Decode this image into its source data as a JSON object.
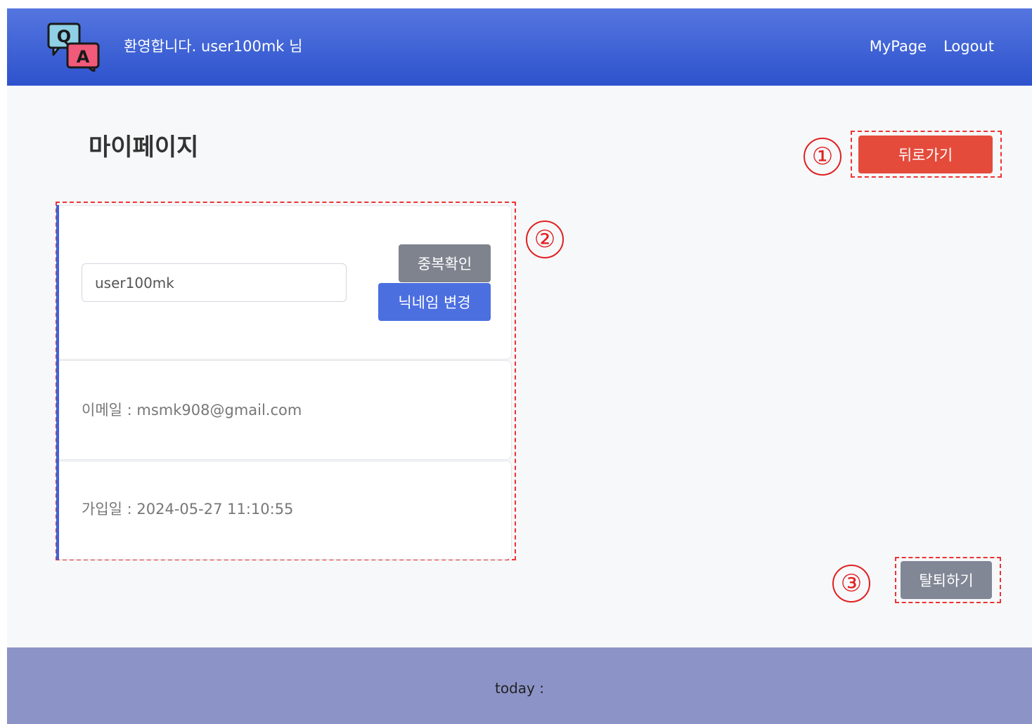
{
  "header": {
    "welcome": "환영합니다. user100mk 님",
    "nav": {
      "mypage": "MyPage",
      "logout": "Logout"
    },
    "logo": {
      "q": "Q",
      "a": "A"
    }
  },
  "page": {
    "title": "마이페이지"
  },
  "markers": {
    "one": "①",
    "two": "②",
    "three": "③"
  },
  "buttons": {
    "back": "뒤로가기",
    "withdraw": "탈퇴하기"
  },
  "profile": {
    "nickname_value": "user100mk",
    "dup_check": "중복확인",
    "change_nickname": "닉네임 변경",
    "email": "이메일 : msmk908@gmail.com",
    "joined": "가입일 : 2024-05-27 11:10:55"
  },
  "footer": {
    "today": "today :"
  },
  "colors": {
    "header": "#2d52cc",
    "back_button": "#e44b3b",
    "gray_button": "#7f838e",
    "blue_button": "#4c6fe0",
    "footer": "#8c93c7",
    "annotation": "#ee3333"
  }
}
